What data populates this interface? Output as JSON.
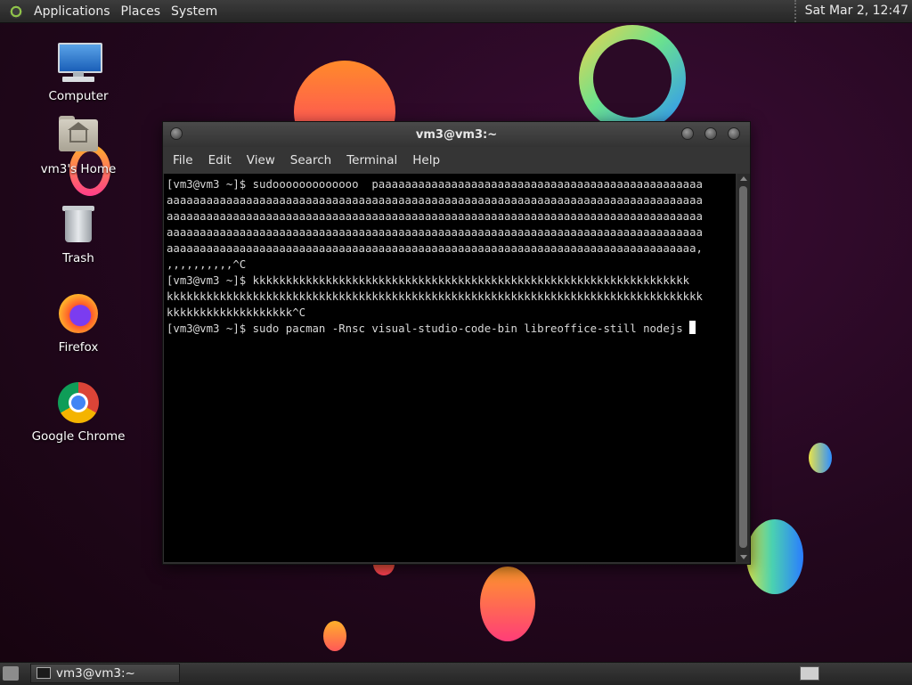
{
  "top_panel": {
    "menus": [
      "Applications",
      "Places",
      "System"
    ],
    "clock": "Sat Mar  2, 12:47"
  },
  "desktop": {
    "icons": [
      {
        "label": "Computer",
        "icon": "computer-icon"
      },
      {
        "label": "vm3's Home",
        "icon": "home-folder-icon"
      },
      {
        "label": "Trash",
        "icon": "trash-icon"
      },
      {
        "label": "Firefox",
        "icon": "firefox-icon"
      },
      {
        "label": "Google Chrome",
        "icon": "chrome-icon"
      }
    ]
  },
  "window": {
    "title": "vm3@vm3:~",
    "menu": [
      "File",
      "Edit",
      "View",
      "Search",
      "Terminal",
      "Help"
    ],
    "terminal_lines": [
      "[vm3@vm3 ~]$ sudooooooooooooo  paaaaaaaaaaaaaaaaaaaaaaaaaaaaaaaaaaaaaaaaaaaaaaaaa",
      "aaaaaaaaaaaaaaaaaaaaaaaaaaaaaaaaaaaaaaaaaaaaaaaaaaaaaaaaaaaaaaaaaaaaaaaaaaaaaaaaa",
      "aaaaaaaaaaaaaaaaaaaaaaaaaaaaaaaaaaaaaaaaaaaaaaaaaaaaaaaaaaaaaaaaaaaaaaaaaaaaaaaaa",
      "aaaaaaaaaaaaaaaaaaaaaaaaaaaaaaaaaaaaaaaaaaaaaaaaaaaaaaaaaaaaaaaaaaaaaaaaaaaaaaaaa",
      "aaaaaaaaaaaaaaaaaaaaaaaaaaaaaaaaaaaaaaaaaaaaaaaaaaaaaaaaaaaaaaaaaaaaaaaaaaaaaaaa,",
      ",,,,,,,,,,^C",
      "[vm3@vm3 ~]$ kkkkkkkkkkkkkkkkkkkkkkkkkkkkkkkkkkkkkkkkkkkkkkkkkkkkkkkkkkkkkkkkkk",
      "kkkkkkkkkkkkkkkkkkkkkkkkkkkkkkkkkkkkkkkkkkkkkkkkkkkkkkkkkkkkkkkkkkkkkkkkkkkkkkkkk",
      "kkkkkkkkkkkkkkkkkkk^C"
    ],
    "current_command": "[vm3@vm3 ~]$ sudo pacman -Rnsc visual-studio-code-bin libreoffice-still nodejs "
  },
  "taskbar": {
    "task_label": "vm3@vm3:~"
  }
}
